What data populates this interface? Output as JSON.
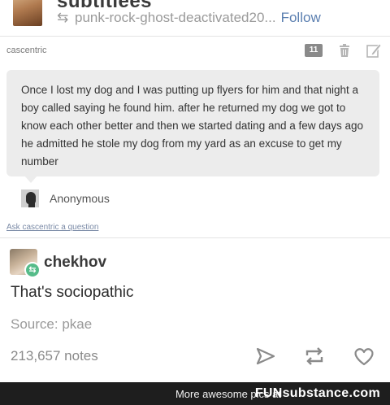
{
  "header": {
    "title": "subtitlees",
    "reblogged_from": "punk-rock-ghost-deactivated20...",
    "follow_label": "Follow"
  },
  "post": {
    "author": "cascentric",
    "count_badge": "11",
    "ask": {
      "text": "Once I lost my dog and I was putting up flyers for him and that night a boy called saying he found him. after he returned my dog we got to know each other better and then we started dating and a few days ago he admitted he stole my dog from my yard as an excuse to get my number",
      "asker": "Anonymous",
      "ask_link": "Ask cascentric a question"
    },
    "reply": {
      "user": "chekhov",
      "text": "That's sociopathic"
    },
    "source_label": "Source:",
    "source_value": "pkae",
    "notes": "213,657 notes"
  },
  "watermark": {
    "text": "More awesome pics at",
    "brand": "FUNsubstance.com"
  },
  "icons": {
    "reblog": "reblog-icon",
    "trash": "trash-icon",
    "edit": "edit-icon",
    "share": "share-icon",
    "like": "heart-icon",
    "anonymous": "anonymous-avatar-icon"
  },
  "colors": {
    "follow": "#5b7fb0",
    "ask_bubble": "#ececec",
    "reblog_badge": "#56bc8a",
    "watermark_bg": "#1e1e1e"
  }
}
